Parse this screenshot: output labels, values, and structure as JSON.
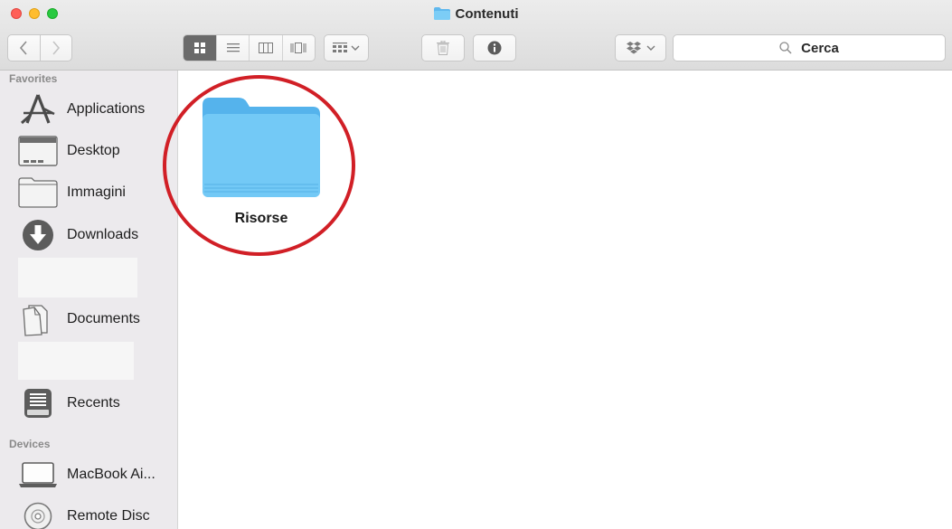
{
  "window": {
    "title": "Contenuti"
  },
  "toolbar": {
    "search_placeholder": "Cerca",
    "view_modes": [
      "icon-view",
      "list-view",
      "column-view",
      "cover-flow-view"
    ],
    "active_view": "icon-view"
  },
  "sidebar": {
    "favorites_title": "Favorites",
    "favorites": [
      {
        "label": "Applications",
        "icon": "applications-icon"
      },
      {
        "label": "Desktop",
        "icon": "desktop-icon"
      },
      {
        "label": "Immagini",
        "icon": "folder-icon"
      },
      {
        "label": "Downloads",
        "icon": "downloads-icon"
      },
      {
        "label": "Documents",
        "icon": "documents-icon"
      },
      {
        "label": "Recents",
        "icon": "recents-icon"
      }
    ],
    "devices_title": "Devices",
    "devices": [
      {
        "label": "MacBook Ai...",
        "icon": "laptop-icon"
      },
      {
        "label": "Remote Disc",
        "icon": "disc-icon"
      }
    ]
  },
  "main": {
    "items": [
      {
        "name": "Risorse",
        "icon": "folder-icon",
        "highlighted": true
      }
    ]
  },
  "colors": {
    "folder": "#6ec6f5",
    "highlight_circle": "#d11f26"
  }
}
